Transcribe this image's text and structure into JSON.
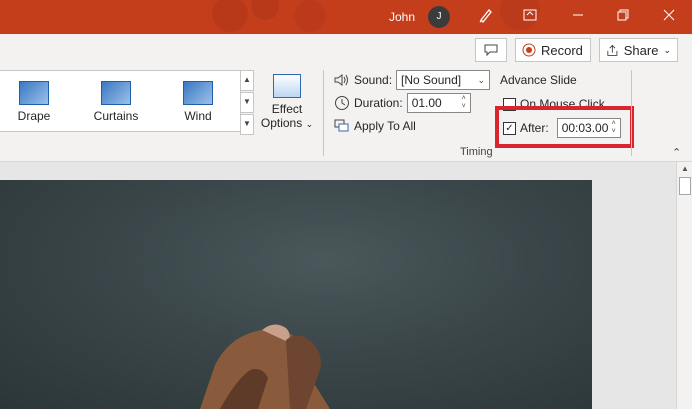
{
  "titlebar": {
    "user_name": "John",
    "avatar_initial": "J",
    "bg_color": "#c43e1c",
    "icons": [
      "pen-icon",
      "ribbon-display-icon",
      "minimize-icon",
      "restore-icon",
      "close-icon"
    ]
  },
  "top_actions": {
    "record_label": "Record",
    "share_label": "Share"
  },
  "transitions_gallery": {
    "items": [
      {
        "label": "Drape",
        "icon": "drape-icon"
      },
      {
        "label": "Curtains",
        "icon": "curtains-icon"
      },
      {
        "label": "Wind",
        "icon": "wind-icon"
      }
    ]
  },
  "effect_options": {
    "line1": "Effect",
    "line2": "Options"
  },
  "timing": {
    "sound_label": "Sound:",
    "sound_value": "[No Sound]",
    "duration_label": "Duration:",
    "duration_value": "01.00",
    "apply_all_label": "Apply To All",
    "advance_slide_label": "Advance Slide",
    "on_mouse_click_label": "On Mouse Click",
    "on_mouse_click_checked": false,
    "after_label": "After:",
    "after_checked": true,
    "after_value": "00:03.00",
    "group_label": "Timing"
  },
  "highlight_color": "#d9252e"
}
